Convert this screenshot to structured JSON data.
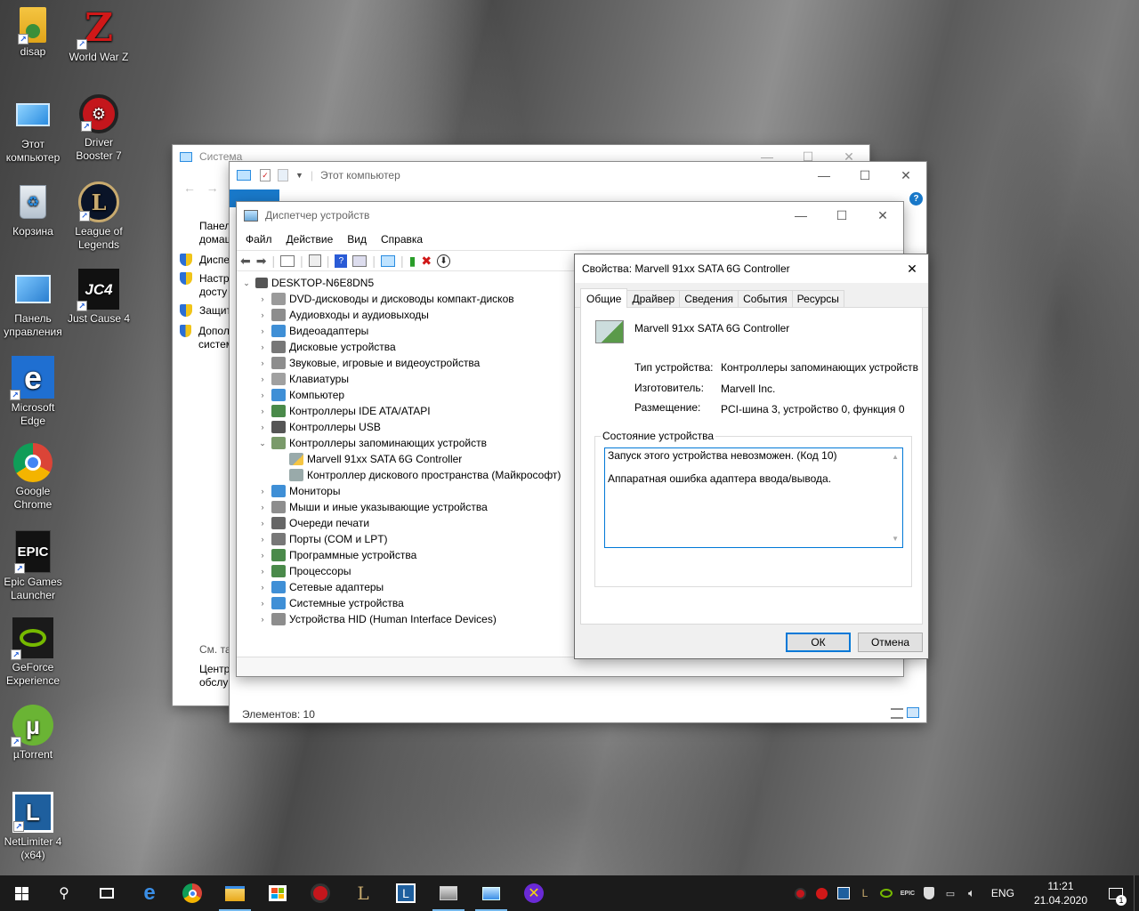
{
  "desktop": {
    "icons": [
      {
        "label": "disap",
        "icon": "folder-user-icon"
      },
      {
        "label": "World War Z",
        "icon": "world-war-z-icon"
      },
      {
        "label": "Этот\nкомпьютер",
        "icon": "this-pc-icon"
      },
      {
        "label": "Driver\nBooster 7",
        "icon": "driver-booster-icon"
      },
      {
        "label": "Корзина",
        "icon": "recycle-bin-icon"
      },
      {
        "label": "League of\nLegends",
        "icon": "league-of-legends-icon"
      },
      {
        "label": "Панель\nуправления",
        "icon": "control-panel-icon"
      },
      {
        "label": "Just Cause 4",
        "icon": "just-cause-4-icon"
      },
      {
        "label": "Microsoft\nEdge",
        "icon": "edge-icon"
      },
      {
        "label": "Google\nChrome",
        "icon": "chrome-icon"
      },
      {
        "label": "Epic Games\nLauncher",
        "icon": "epic-games-icon"
      },
      {
        "label": "GeForce\nExperience",
        "icon": "geforce-icon"
      },
      {
        "label": "µTorrent",
        "icon": "utorrent-icon"
      },
      {
        "label": "NetLimiter 4\n(x64)",
        "icon": "netlimiter-icon"
      }
    ],
    "icon_glyphs": {
      "world_war_z": "Z",
      "just_cause": "JC4",
      "epic": "EPIC"
    }
  },
  "system_window": {
    "title": "Система",
    "sidebar": [
      "Панел",
      "домаш",
      "Диспе",
      "Настр",
      "досту",
      "Защит",
      "Допол",
      "систем"
    ],
    "see_also": "См. та",
    "footer": [
      "Центр",
      "обслу"
    ]
  },
  "explorer_window": {
    "title": "Этот компьютер",
    "status": "Элементов: 10"
  },
  "device_manager": {
    "title": "Диспетчер устройств",
    "menu": [
      "Файл",
      "Действие",
      "Вид",
      "Справка"
    ],
    "root": "DESKTOP-N6E8DN5",
    "categories": [
      {
        "label": "DVD-дисководы и дисководы компакт-дисков",
        "color": "#9a9a9a"
      },
      {
        "label": "Аудиовходы и аудиовыходы",
        "color": "#8d8d8d"
      },
      {
        "label": "Видеоадаптеры",
        "color": "#3f8fd6"
      },
      {
        "label": "Дисковые устройства",
        "color": "#777777"
      },
      {
        "label": "Звуковые, игровые и видеоустройства",
        "color": "#8d8d8d"
      },
      {
        "label": "Клавиатуры",
        "color": "#a0a0a0"
      },
      {
        "label": "Компьютер",
        "color": "#3f8fd6"
      },
      {
        "label": "Контроллеры IDE ATA/ATAPI",
        "color": "#4a8a4a"
      },
      {
        "label": "Контроллеры USB",
        "color": "#555555"
      }
    ],
    "expanded_category": "Контроллеры запоминающих устройств",
    "children": [
      "Marvell 91xx SATA 6G Controller",
      "Контроллер дискового пространства (Майкрософт)"
    ],
    "categories_after": [
      {
        "label": "Мониторы",
        "color": "#3f8fd6"
      },
      {
        "label": "Мыши и иные указывающие устройства",
        "color": "#8d8d8d"
      },
      {
        "label": "Очереди печати",
        "color": "#666666"
      },
      {
        "label": "Порты (COM и LPT)",
        "color": "#777777"
      },
      {
        "label": "Программные устройства",
        "color": "#4a8a4a"
      },
      {
        "label": "Процессоры",
        "color": "#4a8a4a"
      },
      {
        "label": "Сетевые адаптеры",
        "color": "#3f8fd6"
      },
      {
        "label": "Системные устройства",
        "color": "#3f8fd6"
      },
      {
        "label": "Устройства HID (Human Interface Devices)",
        "color": "#8d8d8d"
      }
    ]
  },
  "properties_dialog": {
    "title": "Свойства: Marvell 91xx SATA 6G Controller",
    "tabs": [
      "Общие",
      "Драйвер",
      "Сведения",
      "События",
      "Ресурсы"
    ],
    "device_name": "Marvell 91xx SATA 6G Controller",
    "fields": [
      {
        "label": "Тип устройства:",
        "value": "Контроллеры запоминающих устройств"
      },
      {
        "label": "Изготовитель:",
        "value": "Marvell Inc."
      },
      {
        "label": "Размещение:",
        "value": "PCI-шина 3, устройство 0, функция 0"
      }
    ],
    "status_group": "Состояние устройства",
    "status_lines": [
      "Запуск этого устройства невозможен. (Код 10)",
      "Аппаратная ошибка адаптера ввода/вывода."
    ],
    "ok": "ОК",
    "cancel": "Отмена"
  },
  "taskbar": {
    "lang": "ENG",
    "time": "11:21",
    "date": "21.04.2020",
    "notifications": "1",
    "accent": "#76b9ed"
  }
}
